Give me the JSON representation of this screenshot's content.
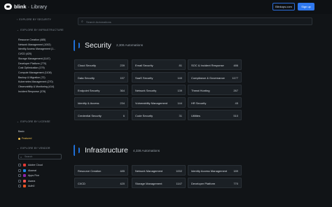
{
  "header": {
    "logo_name": "blink",
    "logo_suffix": "· Library",
    "blinkops_label": "Blinkops.com",
    "signup_label": "Sign up"
  },
  "sidebar": {
    "security_heading": "EXPLORE BY SECURITY",
    "infrastructure_heading": "EXPLORE BY INFRASTRUCTURE",
    "infrastructure_items": [
      "Resource Creation (485)",
      "Network Management (1002)",
      "Identity Access Management (1...",
      "CI/CD (420)",
      "Storage Management (1147)",
      "Developer Platform (770)",
      "Cost Optimization (179)",
      "Compute Management (1108)",
      "Backup & Migration (72)",
      "Kubernetes Management (270)",
      "Observability & Monitoring (414)",
      "Incident Response (378)"
    ],
    "license_heading": "EXPLORE BY LICENSE",
    "license_items": [
      "Basic",
      "Featured"
    ],
    "vendor_heading": "EXPLORE BY VENDOR",
    "vendor_search_placeholder": "Search",
    "vendor_items": [
      {
        "label": "Adobe Cloud",
        "color": "#e53935"
      },
      {
        "label": "Akamai",
        "color": "#1e88e5"
      },
      {
        "label": "Apps Five",
        "color": "#8e24aa"
      },
      {
        "label": "Asana",
        "color": "#ef5350"
      },
      {
        "label": "Auth0",
        "color": "#eb5424"
      }
    ]
  },
  "search": {
    "placeholder": "Search Automations"
  },
  "categories": {
    "security": {
      "title": "Security",
      "count": "2,306 Automations",
      "cards": [
        {
          "label": "Cloud Security",
          "count": "239"
        },
        {
          "label": "Email Security",
          "count": "81"
        },
        {
          "label": "SOC & Incident Response",
          "count": "486"
        },
        {
          "label": "Data Security",
          "count": "157"
        },
        {
          "label": "SaaS Security",
          "count": "140"
        },
        {
          "label": "Compliance & Governance",
          "count": "1177"
        },
        {
          "label": "Endpoint Security",
          "count": "364"
        },
        {
          "label": "Network Security",
          "count": "139"
        },
        {
          "label": "Threat Hunting",
          "count": "267"
        },
        {
          "label": "Identity & Access",
          "count": "234"
        },
        {
          "label": "Vulnerability Management",
          "count": "144"
        },
        {
          "label": "HR Security",
          "count": "45"
        },
        {
          "label": "Credential Security",
          "count": "6"
        },
        {
          "label": "Code Security",
          "count": "31"
        },
        {
          "label": "Utilities",
          "count": "510"
        }
      ]
    },
    "infrastructure": {
      "title": "Infrastructure",
      "count": "4,336 Automations",
      "cards": [
        {
          "label": "Resource Creation",
          "count": "485"
        },
        {
          "label": "Network Management",
          "count": "1002"
        },
        {
          "label": "Identity Access Management",
          "count": "189"
        },
        {
          "label": "CI/CD",
          "count": "420"
        },
        {
          "label": "Storage Management",
          "count": "1147"
        },
        {
          "label": "Developer Platform",
          "count": "770"
        }
      ]
    }
  }
}
